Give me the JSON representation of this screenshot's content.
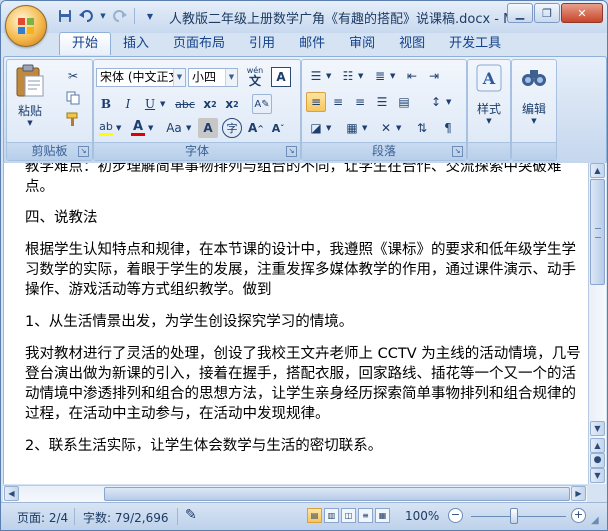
{
  "window": {
    "title": "人教版二年级上册数学广角《有趣的搭配》说课稿.docx - M"
  },
  "quick_access": {
    "icons": [
      "save-icon",
      "undo-icon",
      "redo-icon",
      "customize-icon"
    ]
  },
  "tabs": [
    {
      "label": "开始",
      "active": true
    },
    {
      "label": "插入"
    },
    {
      "label": "页面布局"
    },
    {
      "label": "引用"
    },
    {
      "label": "邮件"
    },
    {
      "label": "审阅"
    },
    {
      "label": "视图"
    },
    {
      "label": "开发工具"
    }
  ],
  "ribbon": {
    "clipboard": {
      "label": "剪贴板",
      "paste_label": "粘贴"
    },
    "font": {
      "label": "字体",
      "font_name": "宋体 (中文正文",
      "font_size": "小四",
      "wen_label": "wén"
    },
    "paragraph": {
      "label": "段落"
    },
    "styles": {
      "label": "样式"
    },
    "editing": {
      "label": "编辑"
    }
  },
  "document": {
    "paragraphs": [
      "教学难点：初步理解简单事物排列与组合的不同，让学生在合作、交流探索中突破难点。",
      "四、说教法",
      "根据学生认知特点和规律，在本节课的设计中，我遵照《课标》的要求和低年级学生学习数学的实际，着眼于学生的发展，注重发挥多媒体教学的作用，通过课件演示、动手操作、游戏活动等方式组织教学。做到",
      "1、从生活情景出发，为学生创设探究学习的情境。",
      "我对教材进行了灵活的处理，创设了我校王文卉老师上 CCTV 为主线的活动情境，几号登台演出做为新课的引入，接着在握手，搭配衣服，回家路线、插花等一个又一个的活动情境中渗透排列和组合的思想方法，让学生亲身经历探索简单事物排列和组合规律的过程，在活动中主动参与，在活动中发现规律。",
      "2、联系生活实际，让学生体会数学与生活的密切联系。"
    ]
  },
  "status_bar": {
    "page": "页面: 2/4",
    "words": "字数: 79/2,696",
    "zoom": "100%",
    "zoom_level": 1.0
  }
}
